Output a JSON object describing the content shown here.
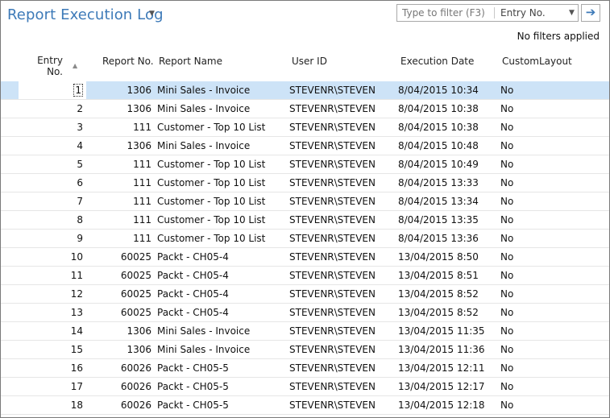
{
  "page": {
    "title": "Report Execution Log",
    "filter": {
      "placeholder": "Type to filter (F3)",
      "field": "Entry No.",
      "status": "No filters applied"
    }
  },
  "columns": {
    "entry_no": "Entry\nNo.",
    "report_no": "Report No.",
    "report_name": "Report Name",
    "user_id": "User ID",
    "execution_date": "Execution Date",
    "custom_layout": "CustomLayout"
  },
  "rows": [
    {
      "entry": "1",
      "report": "1306",
      "name": "Mini Sales - Invoice",
      "user": "STEVENR\\STEVEN",
      "date": "8/04/2015 10:34",
      "layout": "No"
    },
    {
      "entry": "2",
      "report": "1306",
      "name": "Mini Sales - Invoice",
      "user": "STEVENR\\STEVEN",
      "date": "8/04/2015 10:38",
      "layout": "No"
    },
    {
      "entry": "3",
      "report": "111",
      "name": "Customer - Top 10 List",
      "user": "STEVENR\\STEVEN",
      "date": "8/04/2015 10:38",
      "layout": "No"
    },
    {
      "entry": "4",
      "report": "1306",
      "name": "Mini Sales - Invoice",
      "user": "STEVENR\\STEVEN",
      "date": "8/04/2015 10:48",
      "layout": "No"
    },
    {
      "entry": "5",
      "report": "111",
      "name": "Customer - Top 10 List",
      "user": "STEVENR\\STEVEN",
      "date": "8/04/2015 10:49",
      "layout": "No"
    },
    {
      "entry": "6",
      "report": "111",
      "name": "Customer - Top 10 List",
      "user": "STEVENR\\STEVEN",
      "date": "8/04/2015 13:33",
      "layout": "No"
    },
    {
      "entry": "7",
      "report": "111",
      "name": "Customer - Top 10 List",
      "user": "STEVENR\\STEVEN",
      "date": "8/04/2015 13:34",
      "layout": "No"
    },
    {
      "entry": "8",
      "report": "111",
      "name": "Customer - Top 10 List",
      "user": "STEVENR\\STEVEN",
      "date": "8/04/2015 13:35",
      "layout": "No"
    },
    {
      "entry": "9",
      "report": "111",
      "name": "Customer - Top 10 List",
      "user": "STEVENR\\STEVEN",
      "date": "8/04/2015 13:36",
      "layout": "No"
    },
    {
      "entry": "10",
      "report": "60025",
      "name": "Packt - CH05-4",
      "user": "STEVENR\\STEVEN",
      "date": "13/04/2015 8:50",
      "layout": "No"
    },
    {
      "entry": "11",
      "report": "60025",
      "name": "Packt - CH05-4",
      "user": "STEVENR\\STEVEN",
      "date": "13/04/2015 8:51",
      "layout": "No"
    },
    {
      "entry": "12",
      "report": "60025",
      "name": "Packt - CH05-4",
      "user": "STEVENR\\STEVEN",
      "date": "13/04/2015 8:52",
      "layout": "No"
    },
    {
      "entry": "13",
      "report": "60025",
      "name": "Packt - CH05-4",
      "user": "STEVENR\\STEVEN",
      "date": "13/04/2015 8:52",
      "layout": "No"
    },
    {
      "entry": "14",
      "report": "1306",
      "name": "Mini Sales - Invoice",
      "user": "STEVENR\\STEVEN",
      "date": "13/04/2015 11:35",
      "layout": "No"
    },
    {
      "entry": "15",
      "report": "1306",
      "name": "Mini Sales - Invoice",
      "user": "STEVENR\\STEVEN",
      "date": "13/04/2015 11:36",
      "layout": "No"
    },
    {
      "entry": "16",
      "report": "60026",
      "name": "Packt - CH05-5",
      "user": "STEVENR\\STEVEN",
      "date": "13/04/2015 12:11",
      "layout": "No"
    },
    {
      "entry": "17",
      "report": "60026",
      "name": "Packt - CH05-5",
      "user": "STEVENR\\STEVEN",
      "date": "13/04/2015 12:17",
      "layout": "No"
    },
    {
      "entry": "18",
      "report": "60026",
      "name": "Packt - CH05-5",
      "user": "STEVENR\\STEVEN",
      "date": "13/04/2015 12:18",
      "layout": "No"
    }
  ],
  "selected_row": 0,
  "icons": {
    "title_menu": "chevron-down-icon",
    "field_dropdown": "chevron-down-icon",
    "apply_filter": "arrow-right-icon",
    "sort": "sort-ascending-icon"
  },
  "colors": {
    "title": "#3d7ab8",
    "selection": "#cde3f7"
  }
}
